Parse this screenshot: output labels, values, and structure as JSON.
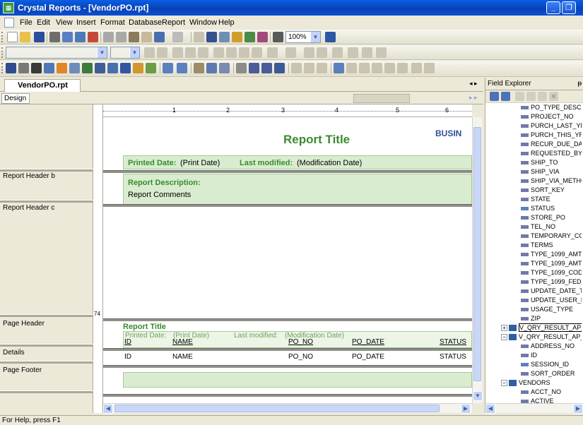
{
  "window": {
    "title": "Crystal Reports - [VendorPO.rpt]"
  },
  "menu": [
    "File",
    "Edit",
    "View",
    "Insert",
    "Format",
    "Database",
    "Report",
    "Window",
    "Help"
  ],
  "toolbar": {
    "zoom": "100%"
  },
  "document_tab": "VendorPO.rpt",
  "design_tab": "Design",
  "sections": [
    {
      "label": "Report Header b"
    },
    {
      "label": "Report Header c"
    },
    {
      "label": "Page Header"
    },
    {
      "label": "Details"
    },
    {
      "label": "Page Footer"
    }
  ],
  "ruler": {
    "marks": [
      "1",
      "2",
      "3",
      "4",
      "5",
      "6"
    ]
  },
  "vertical_ruler_mark": "74",
  "report": {
    "header_a": {
      "title": "Report Title",
      "logo_text": "BUSIN",
      "printed_label": "Printed Date:",
      "printed_value": "(Print Date)",
      "modified_label": "Last modified:",
      "modified_value": "(Modification Date)"
    },
    "header_b": {
      "description_label": "Report Description:",
      "comments": "Report Comments"
    },
    "page_header": {
      "title": "Report Title",
      "printed_label": "Printed Date:",
      "printed_value": "(Print Date)",
      "modified_label": "Last modified:",
      "modified_value": "(Modification Date)",
      "columns": [
        "ID",
        "NAME",
        "PO_NO",
        "PO_DATE",
        "STATUS"
      ]
    },
    "details": {
      "fields": [
        "ID",
        "NAME",
        "PO_NO",
        "PO_DATE",
        "STATUS"
      ]
    }
  },
  "field_explorer": {
    "title": "Field Explorer",
    "fields_top": [
      "PO_TYPE_DESC",
      "PROJECT_NO",
      "PURCH_LAST_YR",
      "PURCH_THIS_YR",
      "RECUR_DUE_DAY",
      "REQUESTED_BY",
      "SHIP_TO",
      "SHIP_VIA",
      "SHIP_VIA_METHO",
      "SORT_KEY",
      "STATE",
      "STATUS",
      "STORE_PO",
      "TEL_NO",
      "TEMPORARY_COD",
      "TERMS",
      "TYPE_1099_AMT_",
      "TYPE_1099_AMT_",
      "TYPE_1099_CODE",
      "TYPE_1099_FED_",
      "UPDATE_DATE_TI",
      "UPDATE_USER_N",
      "USAGE_TYPE",
      "ZIP"
    ],
    "table_1": "V_QRY_RESULT_AP_F",
    "table_2": "V_QRY_RESULT_AP_V",
    "fields_table2": [
      "ADDRESS_NO",
      "ID",
      "SESSION_ID",
      "SORT_ORDER"
    ],
    "table_3": "VENDORS",
    "fields_table3": [
      "ACCT_NO",
      "ACTIVE"
    ]
  },
  "status": "For Help, press F1"
}
